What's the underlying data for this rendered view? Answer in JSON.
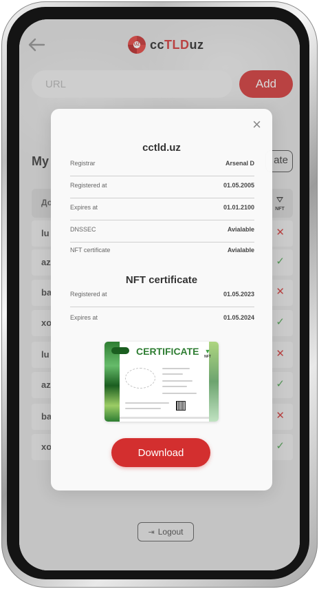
{
  "header": {
    "logo": {
      "text_cc": "cc",
      "text_tld": "TLD",
      "text_uz": "uz",
      "mark_text": "UZ"
    }
  },
  "search": {
    "placeholder": "URL",
    "add_label": "Add"
  },
  "list": {
    "title_partial": "My",
    "action_partial": "ate",
    "header_left": "До",
    "nft_header": "NFT",
    "rows": [
      {
        "name": "lu",
        "status": "x"
      },
      {
        "name": "az",
        "status": "ok"
      },
      {
        "name": "ba",
        "status": "x"
      },
      {
        "name": "xo",
        "status": "ok"
      },
      {
        "name": "lu",
        "status": "x"
      },
      {
        "name": "az",
        "status": "ok"
      },
      {
        "name": "ba",
        "status": "x"
      },
      {
        "name": "xo",
        "status": "ok"
      }
    ]
  },
  "modal": {
    "domain": "cctld.uz",
    "info": [
      {
        "label": "Registrar",
        "value": "Arsenal D"
      },
      {
        "label": "Registered at",
        "value": "01.05.2005"
      },
      {
        "label": "Expires at",
        "value": "01.01.2100"
      },
      {
        "label": "DNSSEC",
        "value": "Avialable"
      },
      {
        "label": "NFT certificate",
        "value": "Avialable"
      }
    ],
    "nft_section_title": "NFT certificate",
    "nft_info": [
      {
        "label": "Registered at",
        "value": "01.05.2023"
      },
      {
        "label": "Expires at",
        "value": "01.05.2024"
      }
    ],
    "certificate": {
      "title": "CERTIFICATE",
      "nft_label": "NFT"
    },
    "download_label": "Download",
    "close_symbol": "×"
  },
  "footer": {
    "logout_label": "Logout"
  },
  "colors": {
    "accent": "#d32f2f",
    "success": "#43a047",
    "screen_bg": "#e2e2e2"
  }
}
